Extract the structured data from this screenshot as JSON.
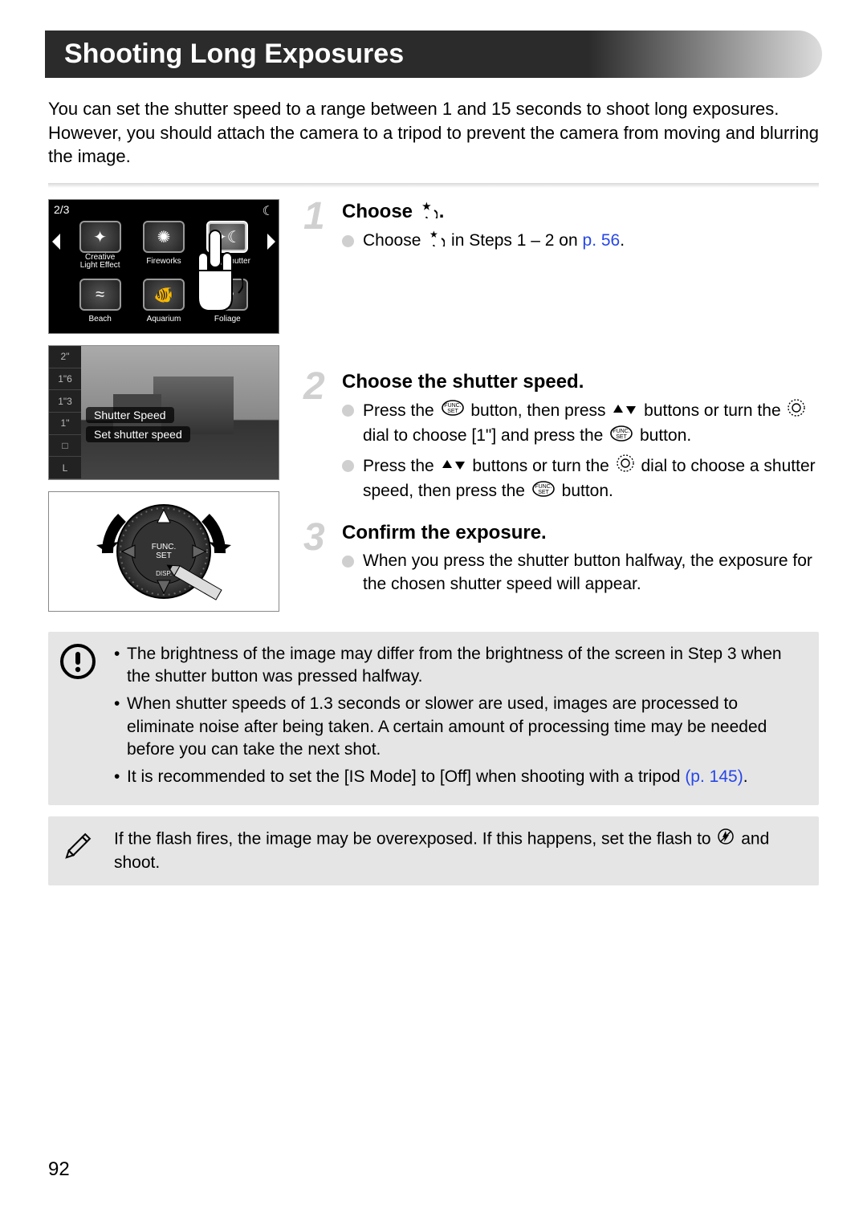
{
  "page_number": "92",
  "title": "Shooting Long Exposures",
  "intro": "You can set the shutter speed to a range between 1 and 15 seconds to shoot long exposures. However, you should attach the camera to a tripod to prevent the camera from moving and blurring the image.",
  "lcd_menu": {
    "pager": "2/3",
    "select_indicator": "☾",
    "tiles": [
      {
        "label": "Creative\nLight Effect",
        "glyph": "✦"
      },
      {
        "label": "Fireworks",
        "glyph": "✺"
      },
      {
        "label": "Long Shutter",
        "glyph": "✦☾",
        "selected": true
      },
      {
        "label": "Beach",
        "glyph": "≈"
      },
      {
        "label": "Aquarium",
        "glyph": "🐠"
      },
      {
        "label": "Foliage",
        "glyph": "❀"
      }
    ]
  },
  "lcd_shutter": {
    "side_values": [
      "2\"",
      "1\"6",
      "1\"3",
      "1\"",
      "□",
      "L"
    ],
    "menu1": "Shutter Speed",
    "menu2": "Set shutter speed"
  },
  "steps": [
    {
      "num": "1",
      "heading_pre": "Choose ",
      "heading_icon": "star-moon",
      "heading_post": ".",
      "bullets": [
        {
          "parts": [
            "Choose ",
            {
              "icon": "star-moon"
            },
            " in Steps 1 – 2 on ",
            {
              "link": "p. 56"
            },
            "."
          ]
        }
      ]
    },
    {
      "num": "2",
      "heading": "Choose the shutter speed.",
      "bullets": [
        {
          "parts": [
            "Press the ",
            {
              "icon": "func-set"
            },
            " button, then press ",
            {
              "icon": "up-down"
            },
            " buttons or turn the ",
            {
              "icon": "dial"
            },
            " dial to choose [1\"] and press the ",
            {
              "icon": "func-set"
            },
            " button."
          ]
        },
        {
          "parts": [
            "Press the ",
            {
              "icon": "up-down"
            },
            " buttons or turn the ",
            {
              "icon": "dial"
            },
            " dial to choose a shutter speed, then press the ",
            {
              "icon": "func-set"
            },
            " button."
          ]
        }
      ]
    },
    {
      "num": "3",
      "heading": "Confirm the exposure.",
      "bullets": [
        {
          "parts": [
            "When you press the shutter button halfway, the exposure for the chosen shutter speed will appear."
          ]
        }
      ]
    }
  ],
  "caution": {
    "items": [
      {
        "parts": [
          "The brightness of the image may differ from the brightness of the screen in Step 3 when the shutter button was pressed halfway."
        ]
      },
      {
        "parts": [
          "When shutter speeds of 1.3 seconds or slower are used, images are processed to eliminate noise after being taken. A certain amount of processing time may be needed before you can take the next shot."
        ]
      },
      {
        "parts": [
          "It is recommended to set the [IS Mode] to [Off] when shooting with a tripod ",
          {
            "link": "(p. 145)"
          },
          "."
        ]
      }
    ]
  },
  "tip": {
    "text_pre": "If the flash fires, the image may be overexposed. If this happens, set the flash to ",
    "text_icon": "flash-off",
    "text_post": " and shoot."
  }
}
